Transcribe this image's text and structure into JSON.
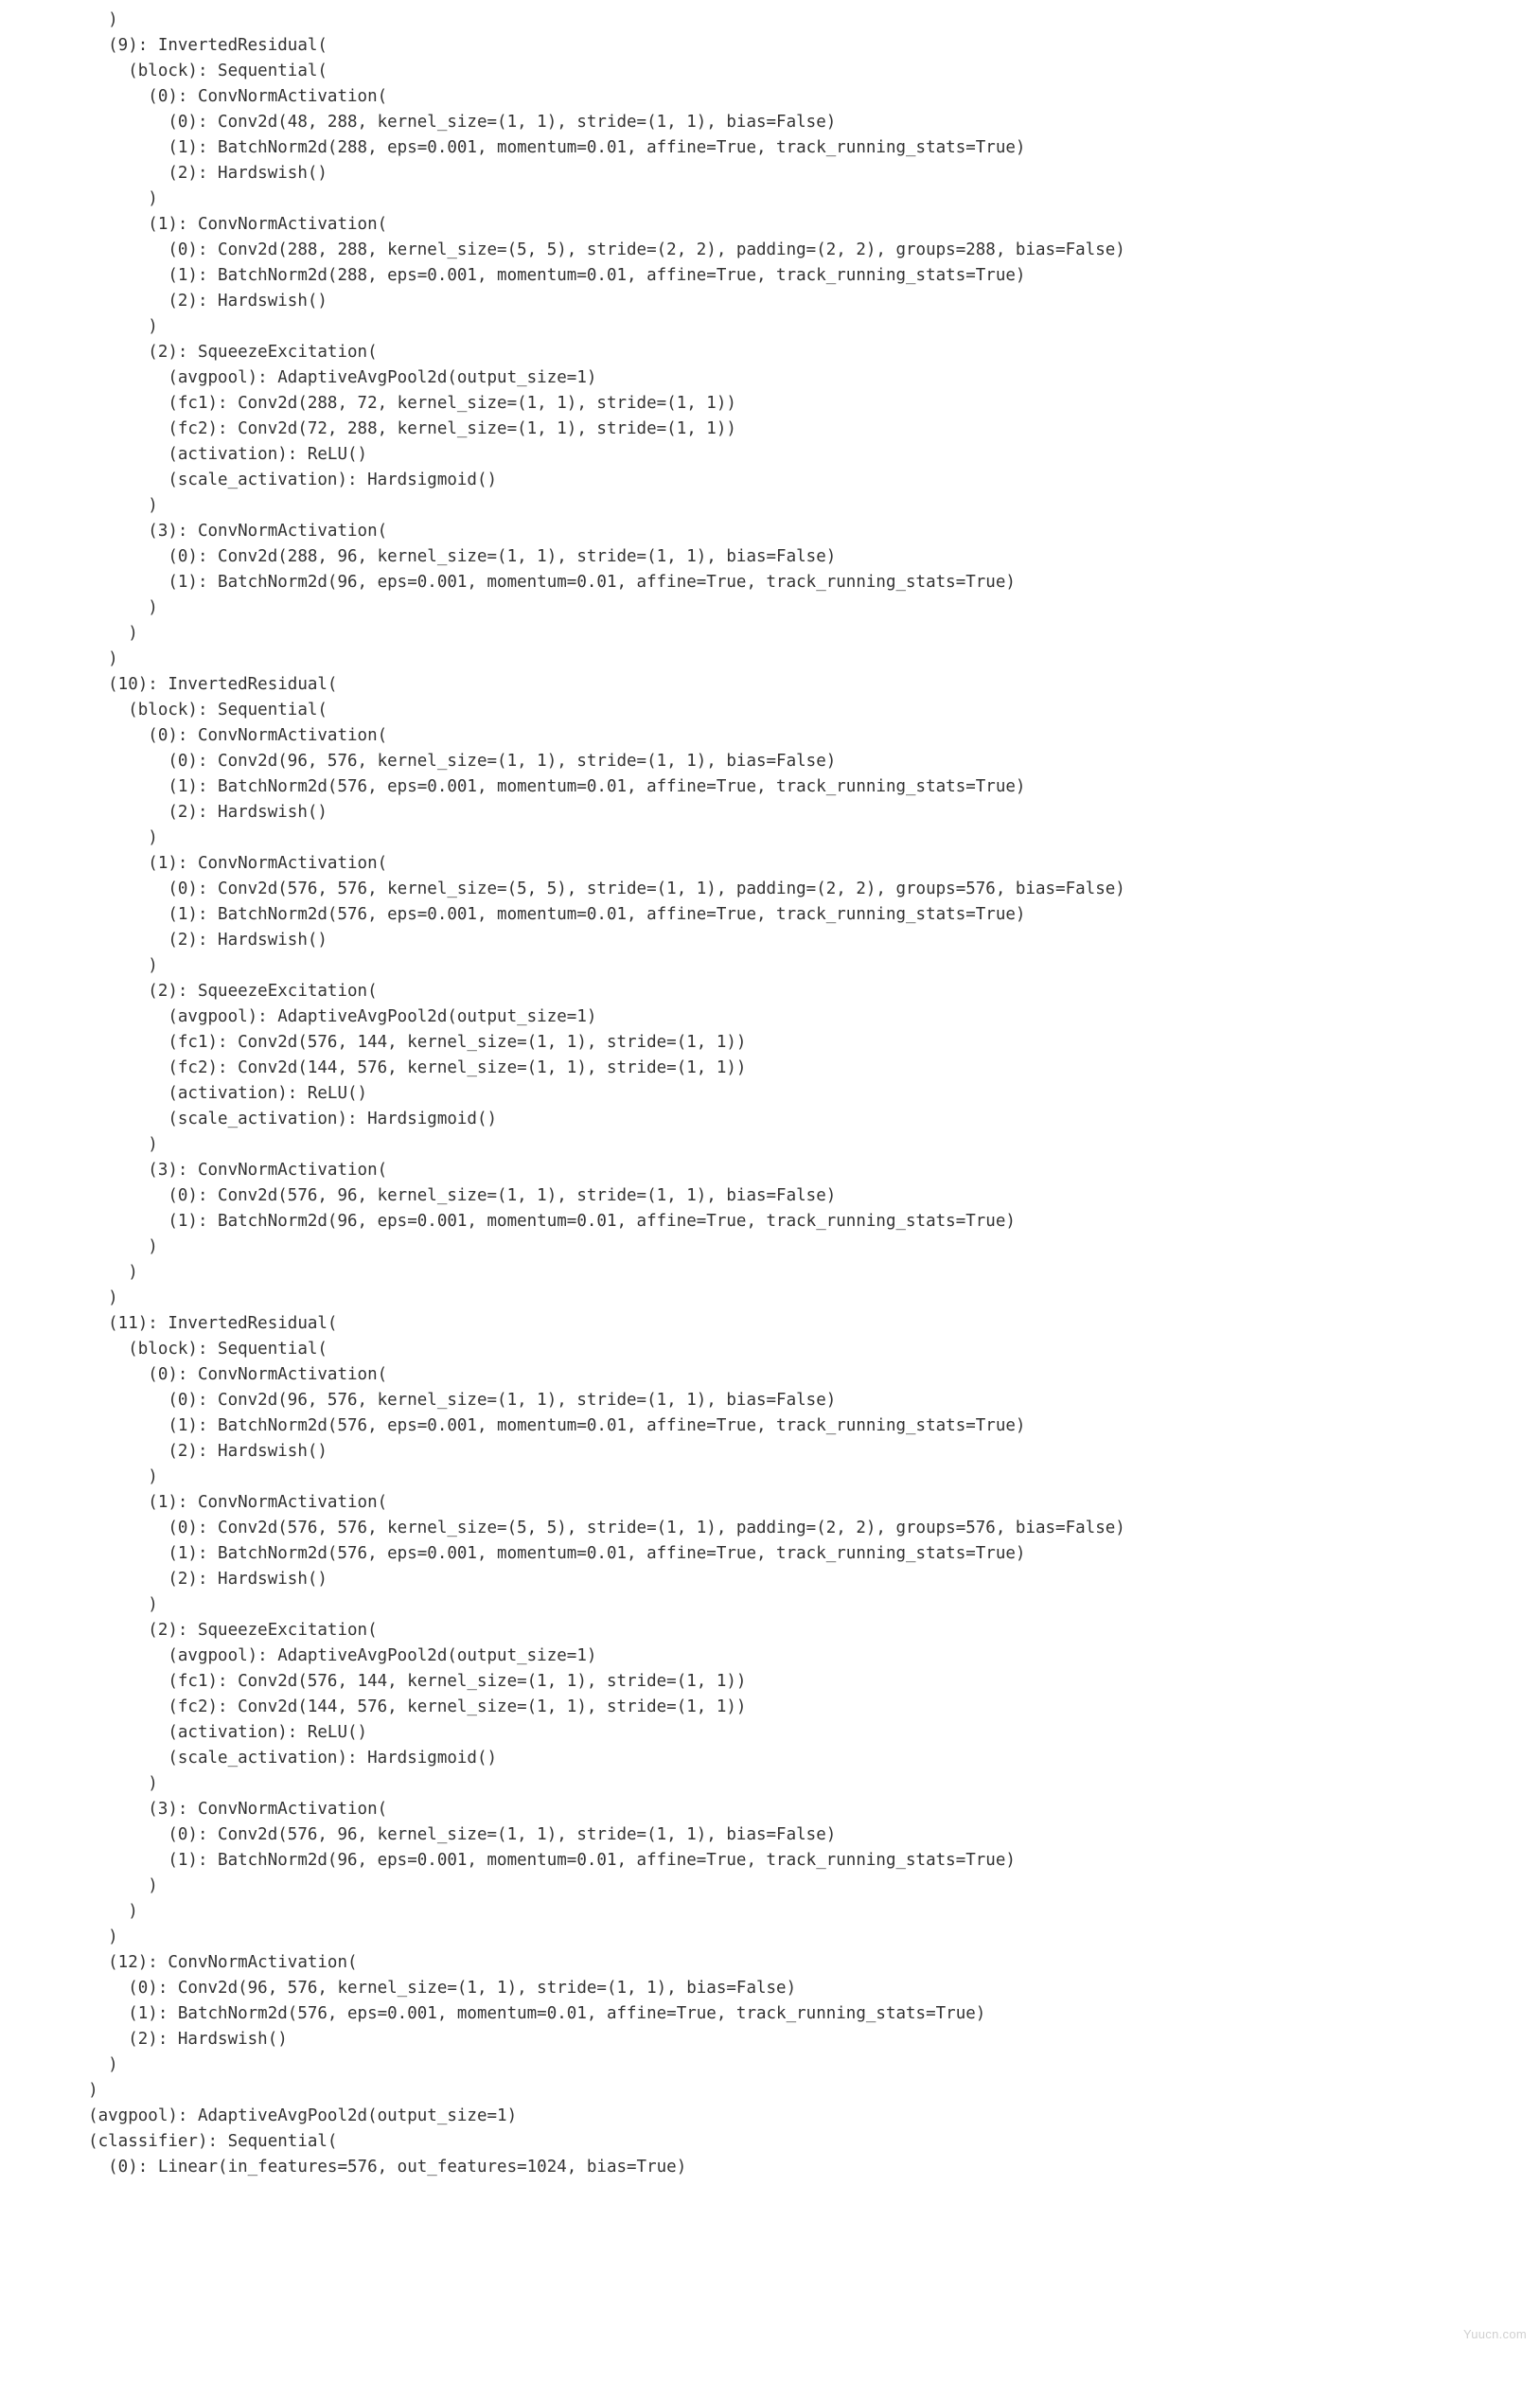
{
  "watermark": "Yuucn.com",
  "code": "    )\n    (9): InvertedResidual(\n      (block): Sequential(\n        (0): ConvNormActivation(\n          (0): Conv2d(48, 288, kernel_size=(1, 1), stride=(1, 1), bias=False)\n          (1): BatchNorm2d(288, eps=0.001, momentum=0.01, affine=True, track_running_stats=True)\n          (2): Hardswish()\n        )\n        (1): ConvNormActivation(\n          (0): Conv2d(288, 288, kernel_size=(5, 5), stride=(2, 2), padding=(2, 2), groups=288, bias=False)\n          (1): BatchNorm2d(288, eps=0.001, momentum=0.01, affine=True, track_running_stats=True)\n          (2): Hardswish()\n        )\n        (2): SqueezeExcitation(\n          (avgpool): AdaptiveAvgPool2d(output_size=1)\n          (fc1): Conv2d(288, 72, kernel_size=(1, 1), stride=(1, 1))\n          (fc2): Conv2d(72, 288, kernel_size=(1, 1), stride=(1, 1))\n          (activation): ReLU()\n          (scale_activation): Hardsigmoid()\n        )\n        (3): ConvNormActivation(\n          (0): Conv2d(288, 96, kernel_size=(1, 1), stride=(1, 1), bias=False)\n          (1): BatchNorm2d(96, eps=0.001, momentum=0.01, affine=True, track_running_stats=True)\n        )\n      )\n    )\n    (10): InvertedResidual(\n      (block): Sequential(\n        (0): ConvNormActivation(\n          (0): Conv2d(96, 576, kernel_size=(1, 1), stride=(1, 1), bias=False)\n          (1): BatchNorm2d(576, eps=0.001, momentum=0.01, affine=True, track_running_stats=True)\n          (2): Hardswish()\n        )\n        (1): ConvNormActivation(\n          (0): Conv2d(576, 576, kernel_size=(5, 5), stride=(1, 1), padding=(2, 2), groups=576, bias=False)\n          (1): BatchNorm2d(576, eps=0.001, momentum=0.01, affine=True, track_running_stats=True)\n          (2): Hardswish()\n        )\n        (2): SqueezeExcitation(\n          (avgpool): AdaptiveAvgPool2d(output_size=1)\n          (fc1): Conv2d(576, 144, kernel_size=(1, 1), stride=(1, 1))\n          (fc2): Conv2d(144, 576, kernel_size=(1, 1), stride=(1, 1))\n          (activation): ReLU()\n          (scale_activation): Hardsigmoid()\n        )\n        (3): ConvNormActivation(\n          (0): Conv2d(576, 96, kernel_size=(1, 1), stride=(1, 1), bias=False)\n          (1): BatchNorm2d(96, eps=0.001, momentum=0.01, affine=True, track_running_stats=True)\n        )\n      )\n    )\n    (11): InvertedResidual(\n      (block): Sequential(\n        (0): ConvNormActivation(\n          (0): Conv2d(96, 576, kernel_size=(1, 1), stride=(1, 1), bias=False)\n          (1): BatchNorm2d(576, eps=0.001, momentum=0.01, affine=True, track_running_stats=True)\n          (2): Hardswish()\n        )\n        (1): ConvNormActivation(\n          (0): Conv2d(576, 576, kernel_size=(5, 5), stride=(1, 1), padding=(2, 2), groups=576, bias=False)\n          (1): BatchNorm2d(576, eps=0.001, momentum=0.01, affine=True, track_running_stats=True)\n          (2): Hardswish()\n        )\n        (2): SqueezeExcitation(\n          (avgpool): AdaptiveAvgPool2d(output_size=1)\n          (fc1): Conv2d(576, 144, kernel_size=(1, 1), stride=(1, 1))\n          (fc2): Conv2d(144, 576, kernel_size=(1, 1), stride=(1, 1))\n          (activation): ReLU()\n          (scale_activation): Hardsigmoid()\n        )\n        (3): ConvNormActivation(\n          (0): Conv2d(576, 96, kernel_size=(1, 1), stride=(1, 1), bias=False)\n          (1): BatchNorm2d(96, eps=0.001, momentum=0.01, affine=True, track_running_stats=True)\n        )\n      )\n    )\n    (12): ConvNormActivation(\n      (0): Conv2d(96, 576, kernel_size=(1, 1), stride=(1, 1), bias=False)\n      (1): BatchNorm2d(576, eps=0.001, momentum=0.01, affine=True, track_running_stats=True)\n      (2): Hardswish()\n    )\n  )\n  (avgpool): AdaptiveAvgPool2d(output_size=1)\n  (classifier): Sequential(\n    (0): Linear(in_features=576, out_features=1024, bias=True)"
}
